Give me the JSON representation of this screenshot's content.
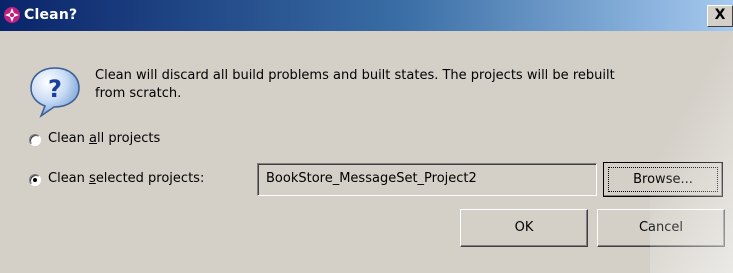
{
  "window": {
    "title": "Clean?",
    "close_glyph": "X"
  },
  "message": {
    "line1": "Clean will discard all build problems and built states.  The projects will be rebuilt",
    "line2": "from scratch."
  },
  "options": {
    "all_prefix": "Clean ",
    "all_mnemonic": "a",
    "all_suffix": "ll projects",
    "all_selected": false,
    "selected_prefix": "Clean ",
    "selected_mnemonic": "s",
    "selected_suffix": "elected projects:",
    "selected_selected": true
  },
  "projects_field": {
    "value": "BookStore_MessageSet_Project2"
  },
  "buttons": {
    "browse": "Browse...",
    "ok": "OK",
    "cancel": "Cancel"
  },
  "colors": {
    "dialog_bg": "#d4d0c8",
    "title_start": "#0a246a",
    "title_end": "#a6caf0"
  },
  "icons": {
    "title": "eclipse-cross-icon",
    "message": "help-question-icon"
  }
}
